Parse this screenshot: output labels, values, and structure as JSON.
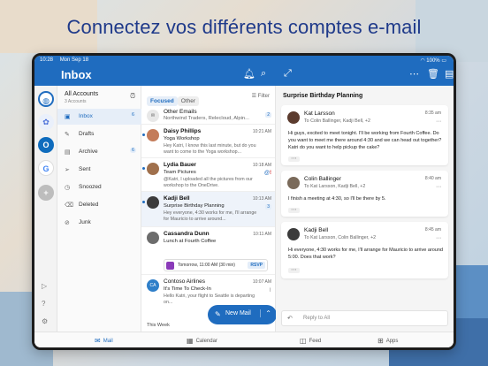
{
  "headline": "Connectez vos différents comptes e-mail",
  "status": {
    "time": "10:28",
    "date": "Mon Sep 18",
    "battery": "100%"
  },
  "header": {
    "title": "Inbox"
  },
  "folders": {
    "title": "All Accounts",
    "subtitle": "3 Accounts",
    "items": [
      {
        "label": "Inbox",
        "count": "6",
        "icon": "inbox-icon"
      },
      {
        "label": "Drafts",
        "count": "",
        "icon": "draft-icon"
      },
      {
        "label": "Archive",
        "count": "6",
        "icon": "archive-icon"
      },
      {
        "label": "Sent",
        "count": "",
        "icon": "send-icon"
      },
      {
        "label": "Snoozed",
        "count": "",
        "icon": "snooze-icon"
      },
      {
        "label": "Deleted",
        "count": "",
        "icon": "trash-icon"
      },
      {
        "label": "Junk",
        "count": "",
        "icon": "junk-icon"
      }
    ]
  },
  "list": {
    "tab_focused": "Focused",
    "tab_other": "Other",
    "filter": "Filter",
    "messages": [
      {
        "sender": "Other Emails",
        "time": "",
        "subject": "Northwind Traders, Relecloud, Alpin...",
        "preview": "",
        "badge": "2"
      },
      {
        "sender": "Daisy Phillips",
        "time": "10:21 AM",
        "subject": "Yoga Workshop",
        "preview": "Hey Katri, I know this last minute, but do you want to come to the Yoga workshop...",
        "badge": ""
      },
      {
        "sender": "Lydia Bauer",
        "time": "10:18 AM",
        "subject": "Team Pictures",
        "preview": "@Katri, I uploaded all the pictures from our workshop to the OneDrive.",
        "badge": ""
      },
      {
        "sender": "Kadji Bell",
        "time": "10:13 AM",
        "subject": "Surprise Birthday Planning",
        "preview": "Hey everyone, 4:30 works for me, I'll arrange for Mauricio to arrive around...",
        "badge": "3"
      },
      {
        "sender": "Cassandra Dunn",
        "time": "10:11 AM",
        "subject": "Lunch at Fourth Coffee",
        "preview": "Tomorrow, 11:00 AM (30 min)",
        "badge": ""
      },
      {
        "sender": "Contoso Airlines",
        "time": "10:07 AM",
        "subject": "It's Time To Check-In",
        "preview": "Hello Katri, your flight to Seattle is departing on...",
        "badge": ""
      }
    ],
    "rsvp": "RSVP",
    "section_label": "This Week",
    "new_mail": "New Mail"
  },
  "reading": {
    "title": "Surprise Birthday Planning",
    "cards": [
      {
        "sender": "Kat Larsson",
        "to": "To Colin Ballinger, Kadji Bell, +2",
        "time": "8:35 am",
        "body": "Hi guys, excited to meet tonight. I'll be working from Fourth Coffee. Do you want to meet me there around 4:30 and we can head out together? Katri do you want to help pickup the cake?"
      },
      {
        "sender": "Colin Ballinger",
        "to": "To Kat Larsson, Kadji Bell, +2",
        "time": "8:40 am",
        "body": "I finish a meeting at 4:30, so I'll be there by 5."
      },
      {
        "sender": "Kadji Bell",
        "to": "To Kat Larsson, Colin Ballinger, +2",
        "time": "8:45 am",
        "body": "Hi everyone, 4:30 works for me, I'll arrange for Mauricio to arrive around 5:00. Does that work?"
      }
    ],
    "reply_placeholder": "Reply to All"
  },
  "bottom": {
    "tabs": [
      {
        "label": "Mail",
        "icon": "mail-icon"
      },
      {
        "label": "Calendar",
        "icon": "calendar-icon"
      },
      {
        "label": "Feed",
        "icon": "feed-icon"
      },
      {
        "label": "Apps",
        "icon": "apps-icon"
      }
    ]
  },
  "colors": {
    "accent": "#1f6cbf",
    "headline": "#1f3a8a"
  }
}
